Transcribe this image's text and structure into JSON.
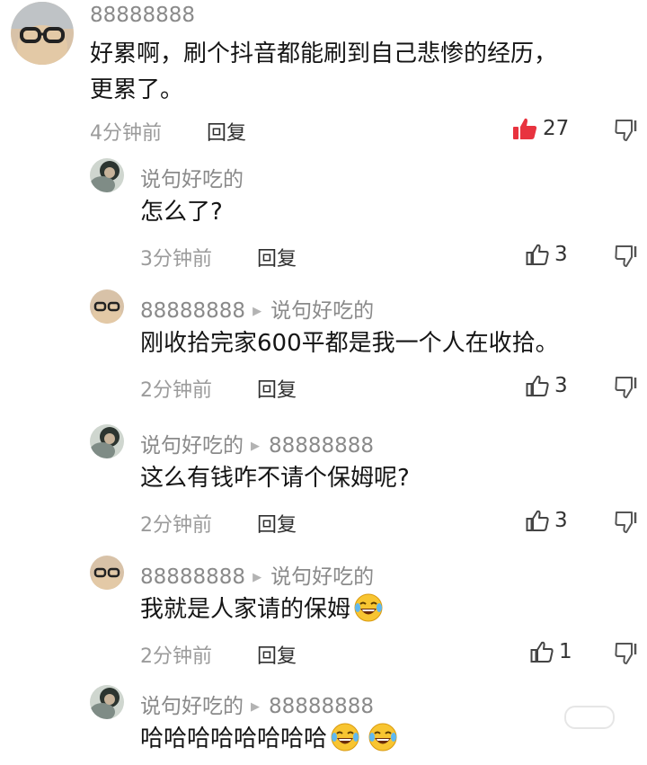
{
  "comment_main": {
    "username": "88888888",
    "text_line1": "好累啊，刷个抖音都能刷到自己悲惨的经历，",
    "text_line2": "更累了。",
    "time": "4分钟前",
    "reply": "回复",
    "likes": "27",
    "liked": true
  },
  "replies": [
    {
      "username": "说句好吃的",
      "reply_to": "",
      "text": "怎么了?",
      "time": "3分钟前",
      "reply": "回复",
      "likes": "3"
    },
    {
      "username": "88888888",
      "reply_to": "说句好吃的",
      "text": "刚收拾完家600平都是我一个人在收拾。",
      "time": "2分钟前",
      "reply": "回复",
      "likes": "3"
    },
    {
      "username": "说句好吃的",
      "reply_to": "88888888",
      "text": "这么有钱咋不请个保姆呢?",
      "time": "2分钟前",
      "reply": "回复",
      "likes": "3"
    },
    {
      "username": "88888888",
      "reply_to": "说句好吃的",
      "text": "我就是人家请的保姆",
      "time": "2分钟前",
      "reply": "回复",
      "likes": "1"
    },
    {
      "username": "说句好吃的",
      "reply_to": "88888888",
      "text": "哈哈哈哈哈哈哈哈",
      "time": "",
      "reply": "",
      "likes": ""
    }
  ],
  "icons": {
    "like": "thumbs-up-icon",
    "dislike": "thumbs-down-icon",
    "reply_arrow": "triangle-right-icon",
    "emoji": "laughing-crying-emoji"
  },
  "colors": {
    "like_active": "#e8333f",
    "muted": "#9b9b9b"
  }
}
